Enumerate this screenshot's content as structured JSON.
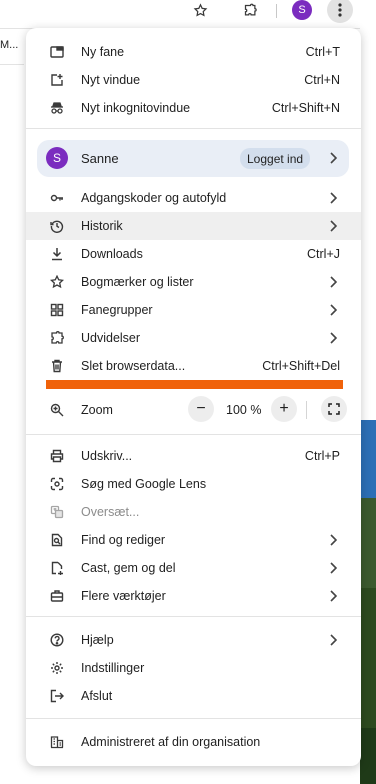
{
  "toolbar": {
    "avatar_initial": "S",
    "left_fragment": "M..."
  },
  "profile": {
    "initial": "S",
    "name": "Sanne",
    "status": "Logget ind"
  },
  "zoom": {
    "label": "Zoom",
    "minus": "−",
    "level": "100 %",
    "plus": "+"
  },
  "menu": {
    "new_tab": {
      "label": "Ny fane",
      "shortcut": "Ctrl+T"
    },
    "new_window": {
      "label": "Nyt vindue",
      "shortcut": "Ctrl+N"
    },
    "incognito": {
      "label": "Nyt inkognitovindue",
      "shortcut": "Ctrl+Shift+N"
    },
    "passwords": {
      "label": "Adgangskoder og autofyld"
    },
    "history": {
      "label": "Historik"
    },
    "downloads": {
      "label": "Downloads",
      "shortcut": "Ctrl+J"
    },
    "bookmarks": {
      "label": "Bogmærker og lister"
    },
    "tab_groups": {
      "label": "Fanegrupper"
    },
    "extensions": {
      "label": "Udvidelser"
    },
    "clear_data": {
      "label": "Slet browserdata...",
      "shortcut": "Ctrl+Shift+Del"
    },
    "print": {
      "label": "Udskriv...",
      "shortcut": "Ctrl+P"
    },
    "lens": {
      "label": "Søg med Google Lens"
    },
    "translate": {
      "label": "Oversæt..."
    },
    "find": {
      "label": "Find og rediger"
    },
    "cast": {
      "label": "Cast, gem og del"
    },
    "more_tools": {
      "label": "Flere værktøjer"
    },
    "help": {
      "label": "Hjælp"
    },
    "settings": {
      "label": "Indstillinger"
    },
    "exit": {
      "label": "Afslut"
    },
    "managed": {
      "label": "Administreret af din organisation"
    }
  },
  "colors": {
    "profile_accent": "#7b2cbf",
    "highlight_bar": "#f0620a",
    "profile_background": "#e9eef6"
  }
}
